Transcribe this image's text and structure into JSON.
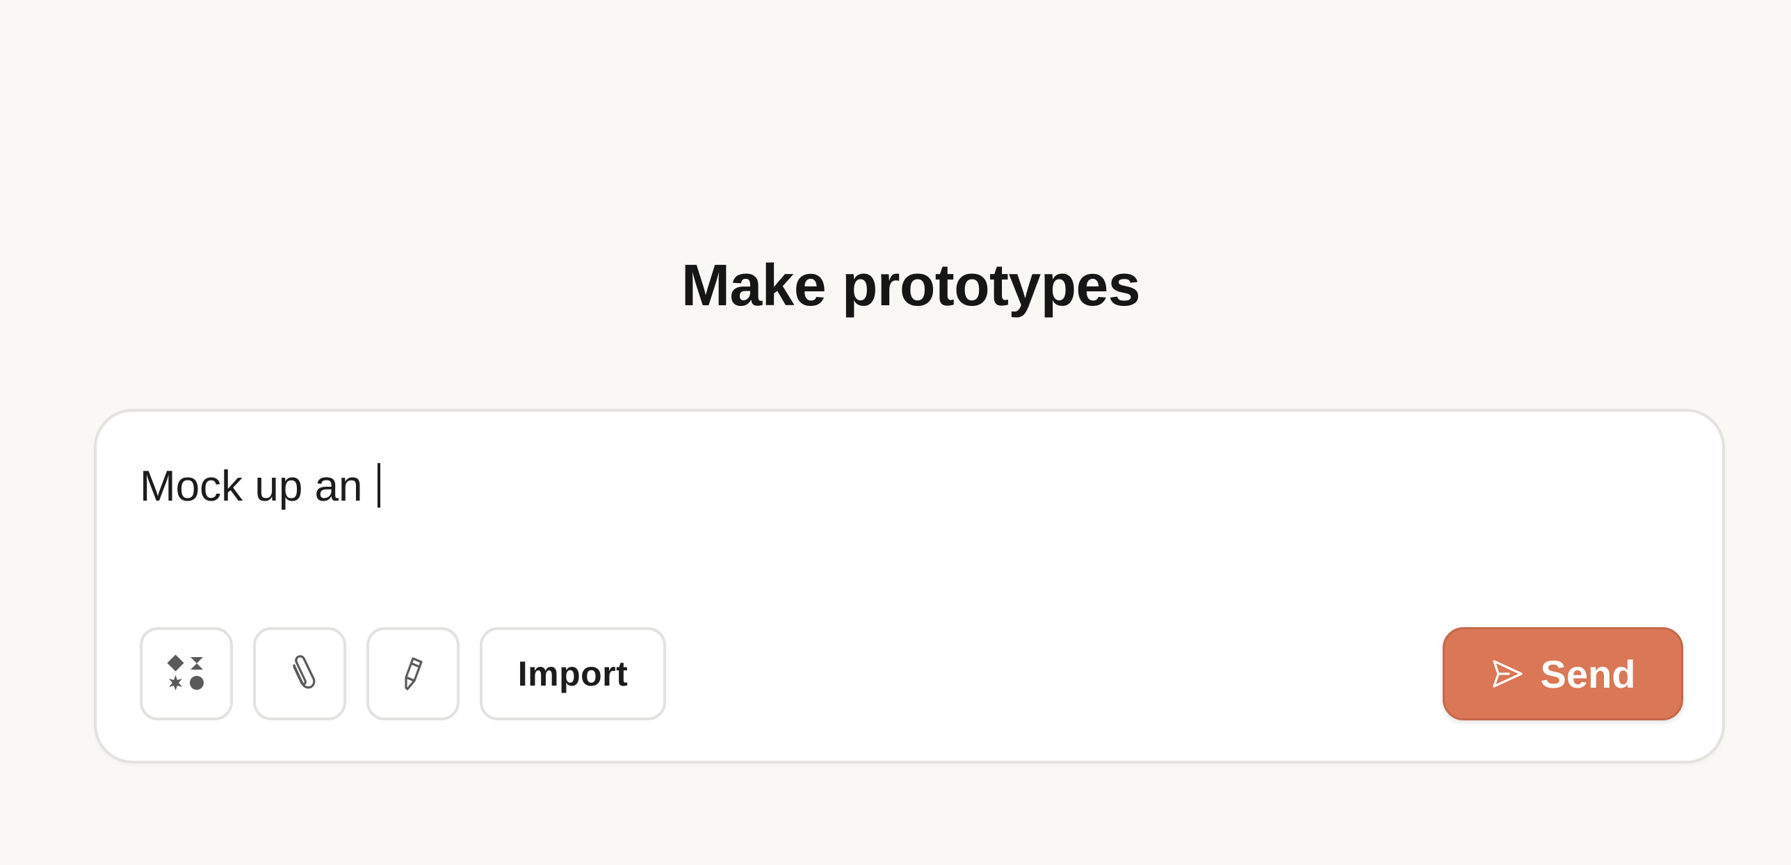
{
  "page": {
    "title": "Make prototypes"
  },
  "composer": {
    "input_value": "Mock up an "
  },
  "toolbar": {
    "import_label": "Import",
    "send_label": "Send"
  },
  "icons": {
    "shapes": "shapes-icon",
    "attach": "paperclip-icon",
    "draw": "pencil-icon",
    "send": "send-icon"
  },
  "colors": {
    "background": "#f9f8f5",
    "accent": "#d97757",
    "title": "#161616"
  }
}
